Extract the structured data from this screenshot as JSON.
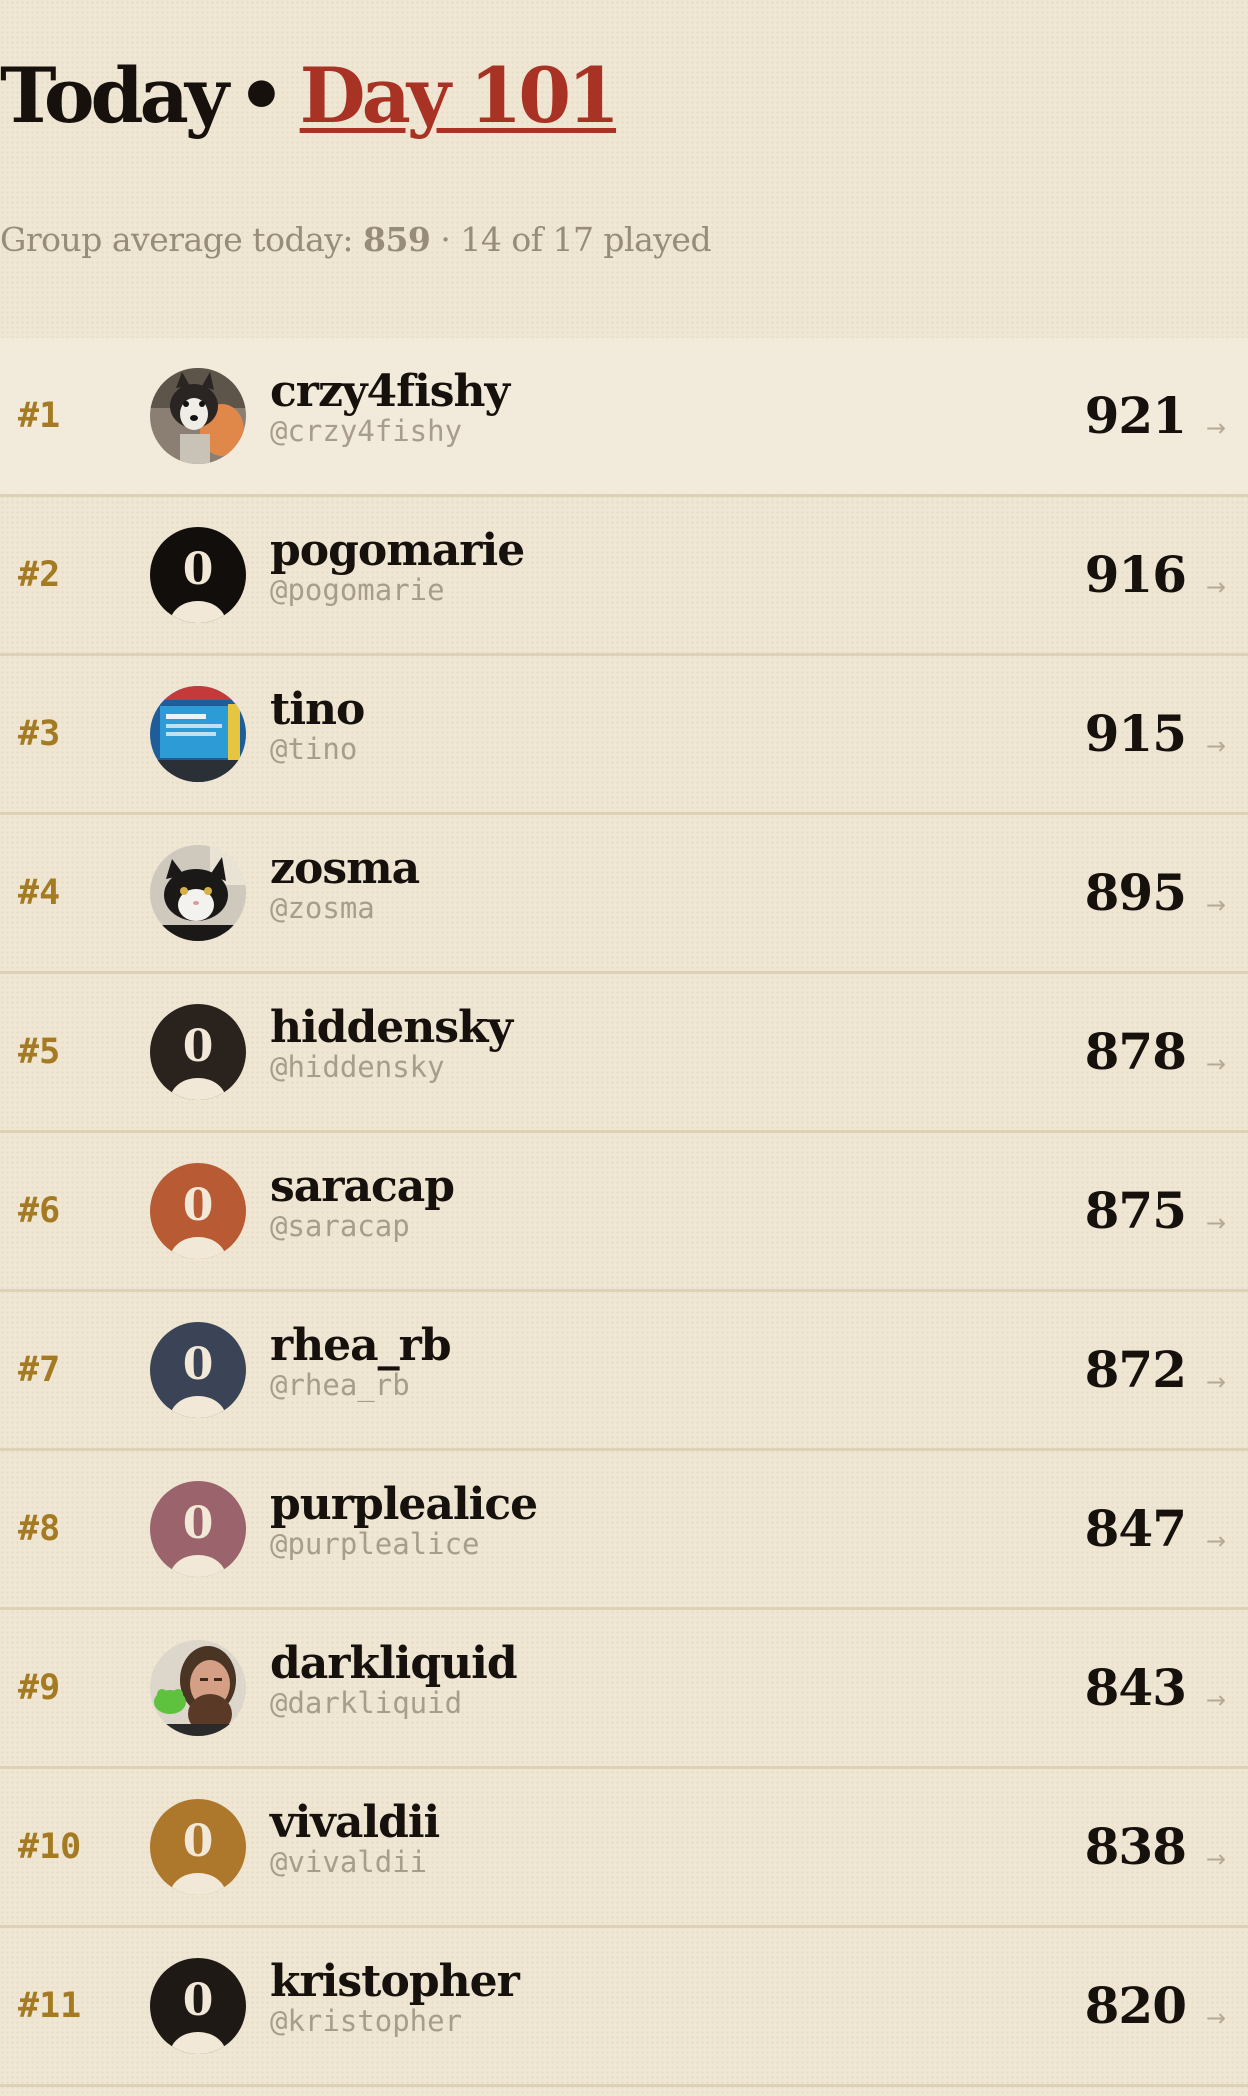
{
  "header": {
    "today": "Today",
    "separator": "•",
    "day": "Day 101"
  },
  "summary": {
    "prefix": "Group average today:",
    "average": "859",
    "separator": "·",
    "played": "14 of 17 played"
  },
  "arrow_glyph": "→",
  "avatar_glyph": "0",
  "leaderboard": [
    {
      "rank": "#1",
      "name": "crzy4fishy",
      "handle": "@crzy4fishy",
      "score": "921",
      "avatar": "photo-dog"
    },
    {
      "rank": "#2",
      "name": "pogomarie",
      "handle": "@pogomarie",
      "score": "916",
      "avatar": "default",
      "color": "#120e0b"
    },
    {
      "rank": "#3",
      "name": "tino",
      "handle": "@tino",
      "score": "915",
      "avatar": "photo-screen"
    },
    {
      "rank": "#4",
      "name": "zosma",
      "handle": "@zosma",
      "score": "895",
      "avatar": "photo-cat"
    },
    {
      "rank": "#5",
      "name": "hiddensky",
      "handle": "@hiddensky",
      "score": "878",
      "avatar": "default",
      "color": "#2a231d"
    },
    {
      "rank": "#6",
      "name": "saracap",
      "handle": "@saracap",
      "score": "875",
      "avatar": "default",
      "color": "#b85a34"
    },
    {
      "rank": "#7",
      "name": "rhea_rb",
      "handle": "@rhea_rb",
      "score": "872",
      "avatar": "default",
      "color": "#3a4456"
    },
    {
      "rank": "#8",
      "name": "purplealice",
      "handle": "@purplealice",
      "score": "847",
      "avatar": "default",
      "color": "#9b636b"
    },
    {
      "rank": "#9",
      "name": "darkliquid",
      "handle": "@darkliquid",
      "score": "843",
      "avatar": "photo-man"
    },
    {
      "rank": "#10",
      "name": "vivaldii",
      "handle": "@vivaldii",
      "score": "838",
      "avatar": "default",
      "color": "#ad772c"
    },
    {
      "rank": "#11",
      "name": "kristopher",
      "handle": "@kristopher",
      "score": "820",
      "avatar": "default",
      "color": "#1f1915"
    }
  ],
  "colors": {
    "accent": "#a83325",
    "rank": "#a47a22",
    "background": "#efe6d3",
    "muted": "#978b7a"
  }
}
